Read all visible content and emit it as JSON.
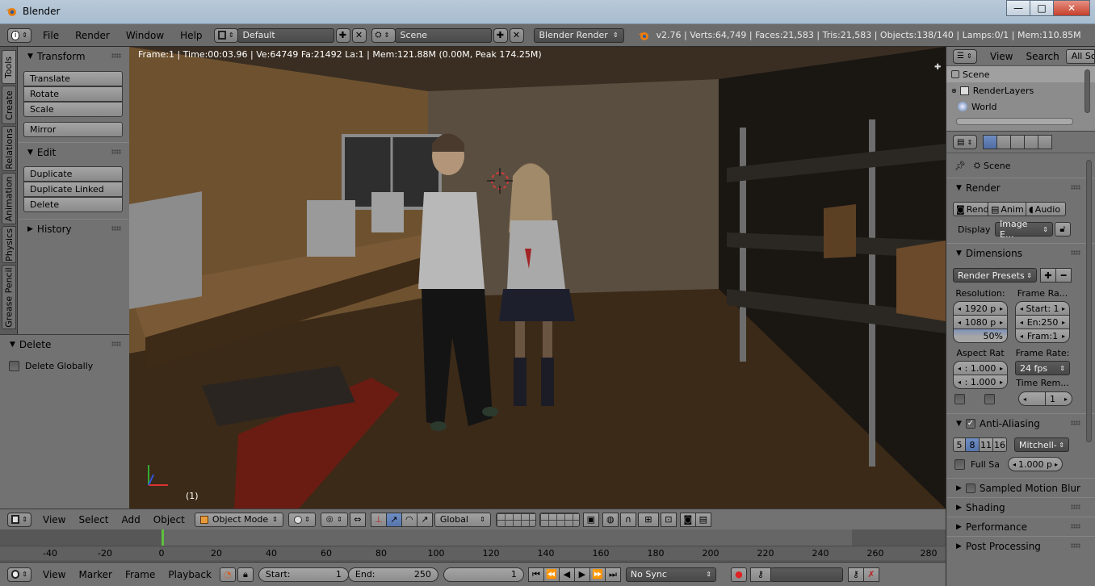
{
  "window": {
    "title": "Blender",
    "minimize": "—",
    "maximize": "□",
    "close": "✕"
  },
  "topbar": {
    "menus": [
      "File",
      "Render",
      "Window",
      "Help"
    ],
    "layout": "Default",
    "scene": "Scene",
    "engine": "Blender Render",
    "stats": "v2.76 | Verts:64,749 | Faces:21,583 | Tris:21,583 | Objects:138/140 | Lamps:0/1 | Mem:110.85M"
  },
  "tooltabs": [
    "Tools",
    "Create",
    "Relations",
    "Animation",
    "Physics",
    "Grease Pencil"
  ],
  "toolshelf": {
    "transform": {
      "title": "Transform",
      "buttons": [
        "Translate",
        "Rotate",
        "Scale"
      ],
      "mirror": "Mirror"
    },
    "edit": {
      "title": "Edit",
      "buttons": [
        "Duplicate",
        "Duplicate Linked",
        "Delete"
      ]
    },
    "history": {
      "title": "History"
    }
  },
  "operator": {
    "title": "Delete",
    "option": "Delete Globally"
  },
  "viewport": {
    "info": "Frame:1 | Time:00:03.96 | Ve:64749 Fa:21492 La:1 | Mem:121.88M (0.00M, Peak 174.25M)",
    "frame": "(1)"
  },
  "view3d_header": {
    "menus": [
      "View",
      "Select",
      "Add",
      "Object"
    ],
    "mode": "Object Mode",
    "orientation": "Global"
  },
  "timeline": {
    "ticks": [
      "-40",
      "-20",
      "0",
      "20",
      "40",
      "60",
      "80",
      "100",
      "120",
      "140",
      "160",
      "180",
      "200",
      "220",
      "240",
      "260",
      "280"
    ],
    "menus": [
      "View",
      "Marker",
      "Frame",
      "Playback"
    ],
    "start_label": "Start:",
    "start": "1",
    "end_label": "End:",
    "end": "250",
    "current": "1",
    "sync": "No Sync"
  },
  "outliner": {
    "menus": [
      "View",
      "Search"
    ],
    "filter": "All Sc",
    "items": [
      "Scene",
      "RenderLayers",
      "World"
    ]
  },
  "properties": {
    "context": "Scene",
    "render": {
      "title": "Render",
      "rend": "Rend",
      "anim": "Anim",
      "audio": "Audio",
      "display_label": "Display",
      "display": "Image E..."
    },
    "dimensions": {
      "title": "Dimensions",
      "presets": "Render Presets",
      "resolution_label": "Resolution:",
      "res_x": "1920 p",
      "res_y": "1080 p",
      "res_pct": "50%",
      "frame_range_label": "Frame Ra...",
      "start": "Start: 1",
      "end": "En:250",
      "frame": "Fram:1",
      "aspect_label": "Aspect Rat",
      "aspect_x": ": 1.000",
      "aspect_y": ": 1.000",
      "frame_rate_label": "Frame Rate:",
      "fps": "24 fps",
      "time_remap_label": "Time Rem...",
      "time_remap": "1"
    },
    "antialiasing": {
      "title": "Anti-Aliasing",
      "samples": [
        "5",
        "8",
        "11",
        "16"
      ],
      "filter": "Mitchell-",
      "full_sample": "Full Sa",
      "size": "1.000 p"
    },
    "sections": [
      "Sampled Motion Blur",
      "Shading",
      "Performance",
      "Post Processing"
    ]
  }
}
